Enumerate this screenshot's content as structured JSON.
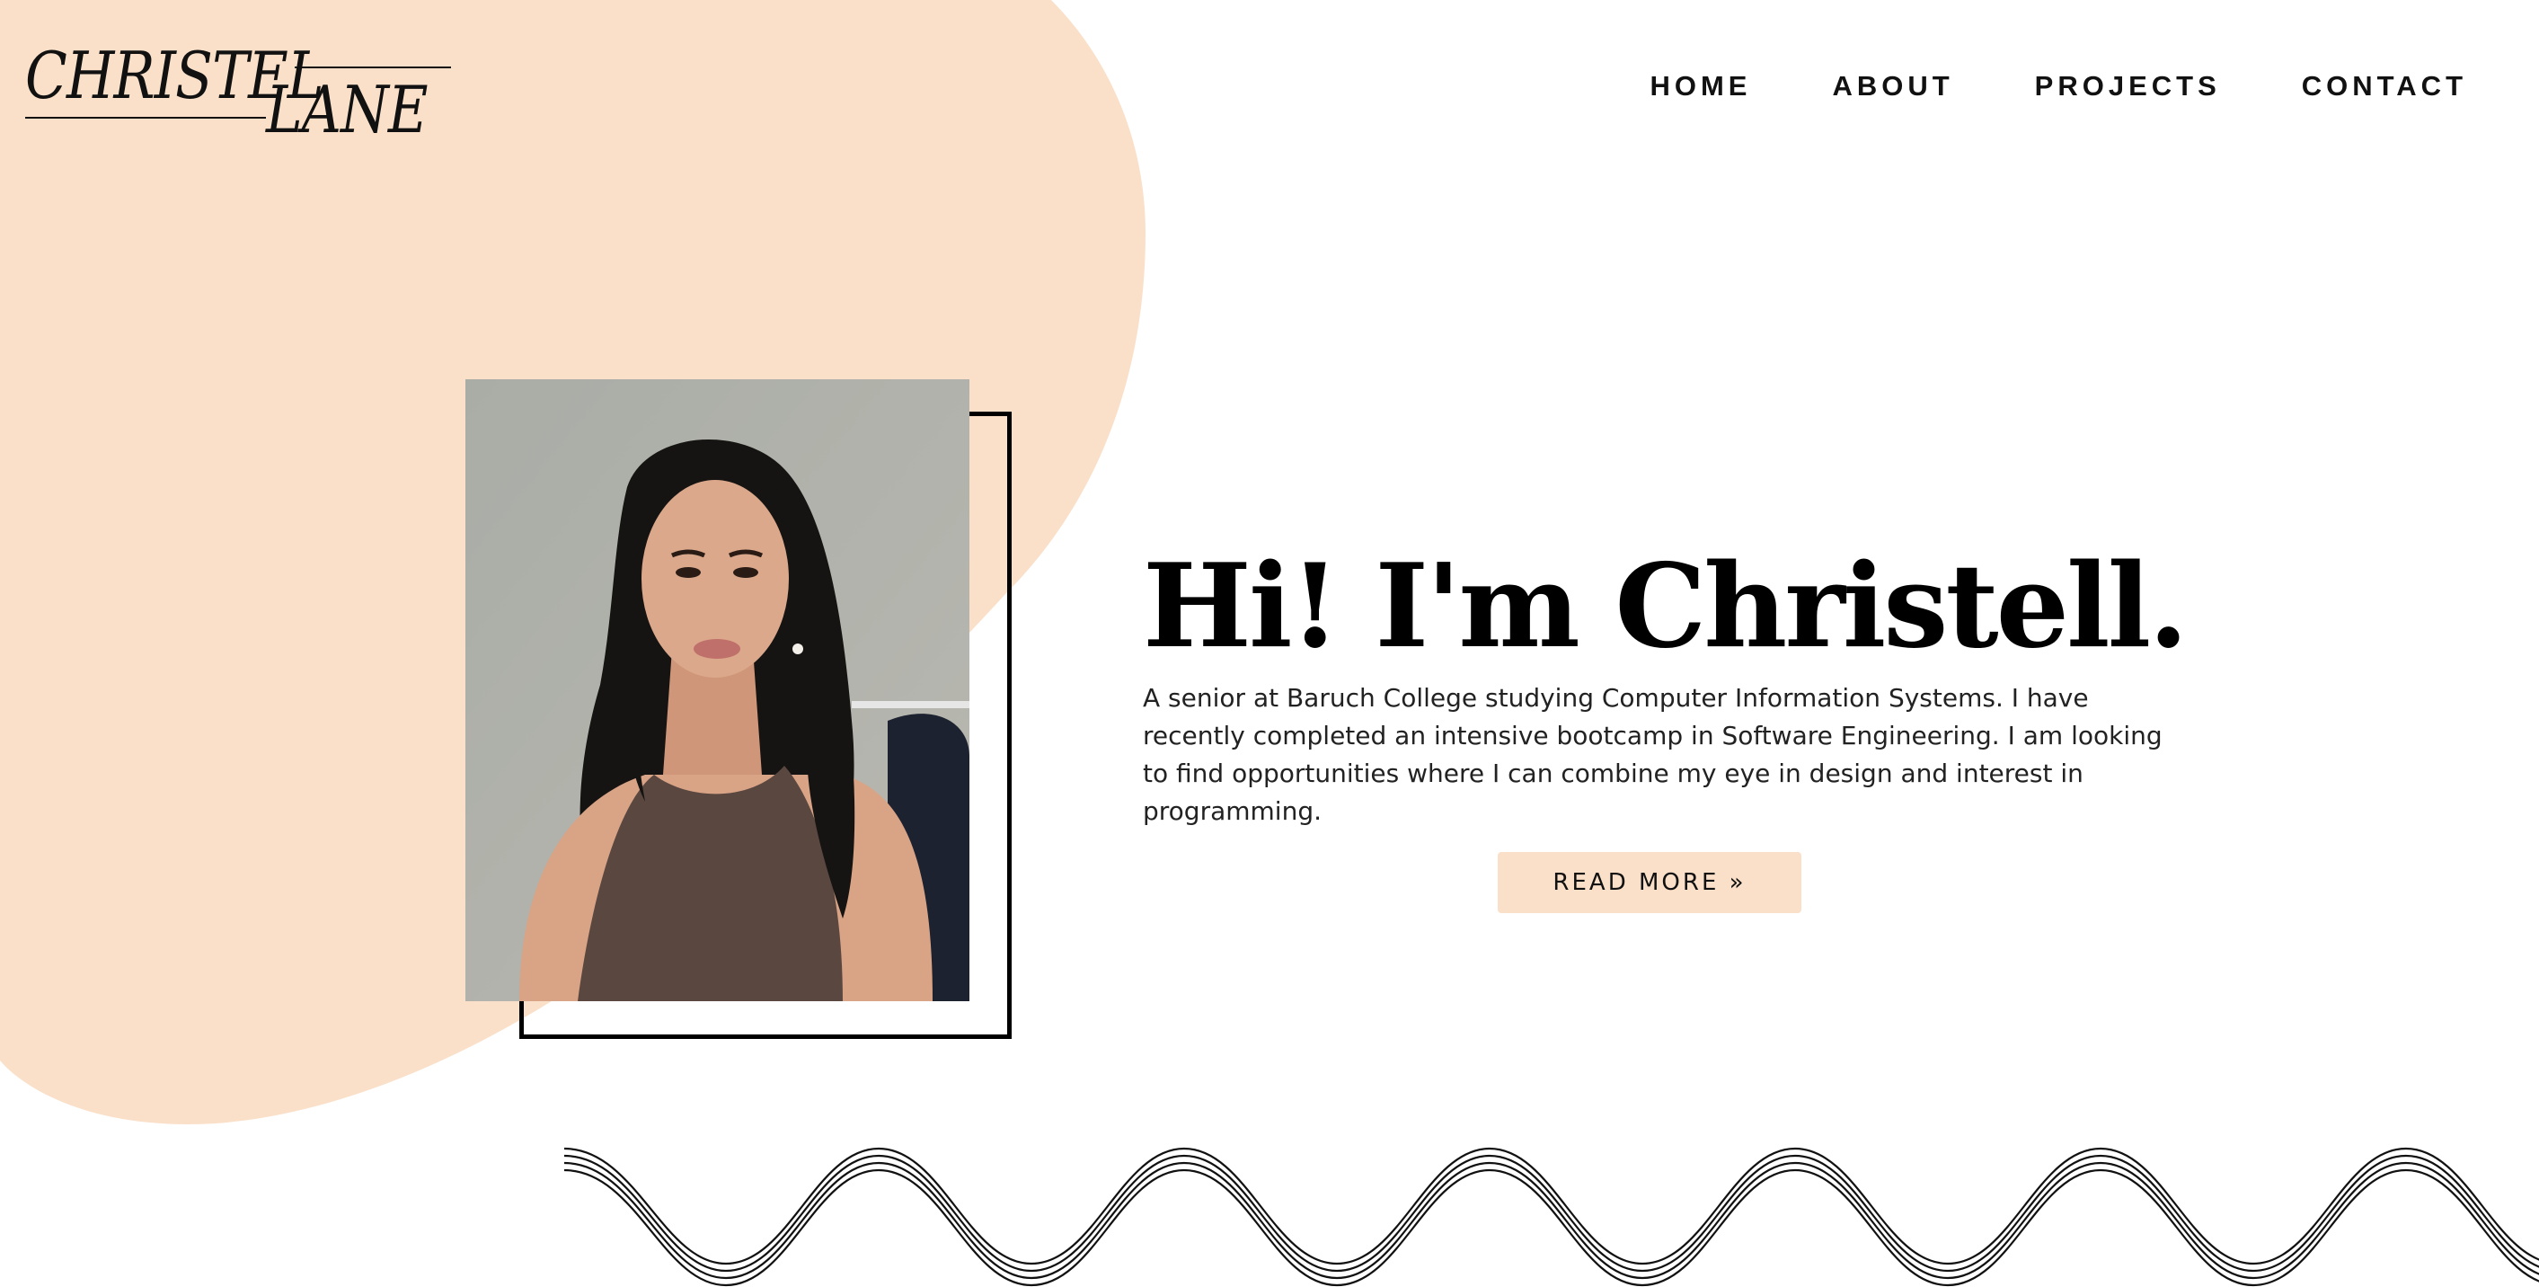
{
  "logo": {
    "line1": "CHRISTEL",
    "line2": "LANE"
  },
  "nav": {
    "items": [
      {
        "label": "HOME"
      },
      {
        "label": "ABOUT"
      },
      {
        "label": "PROJECTS"
      },
      {
        "label": "CONTACT"
      }
    ]
  },
  "hero": {
    "title": "Hi! I'm Christell.",
    "description": "A senior at Baruch College studying Computer Information Systems. I have recently completed an intensive bootcamp in Software Engineering. I am looking to find opportunities where I can combine my eye in design and interest in programming.",
    "read_more_label": "READ MORE »"
  },
  "colors": {
    "accent_peach": "#fae0c9",
    "text_dark": "#111111",
    "background": "#ffffff"
  }
}
